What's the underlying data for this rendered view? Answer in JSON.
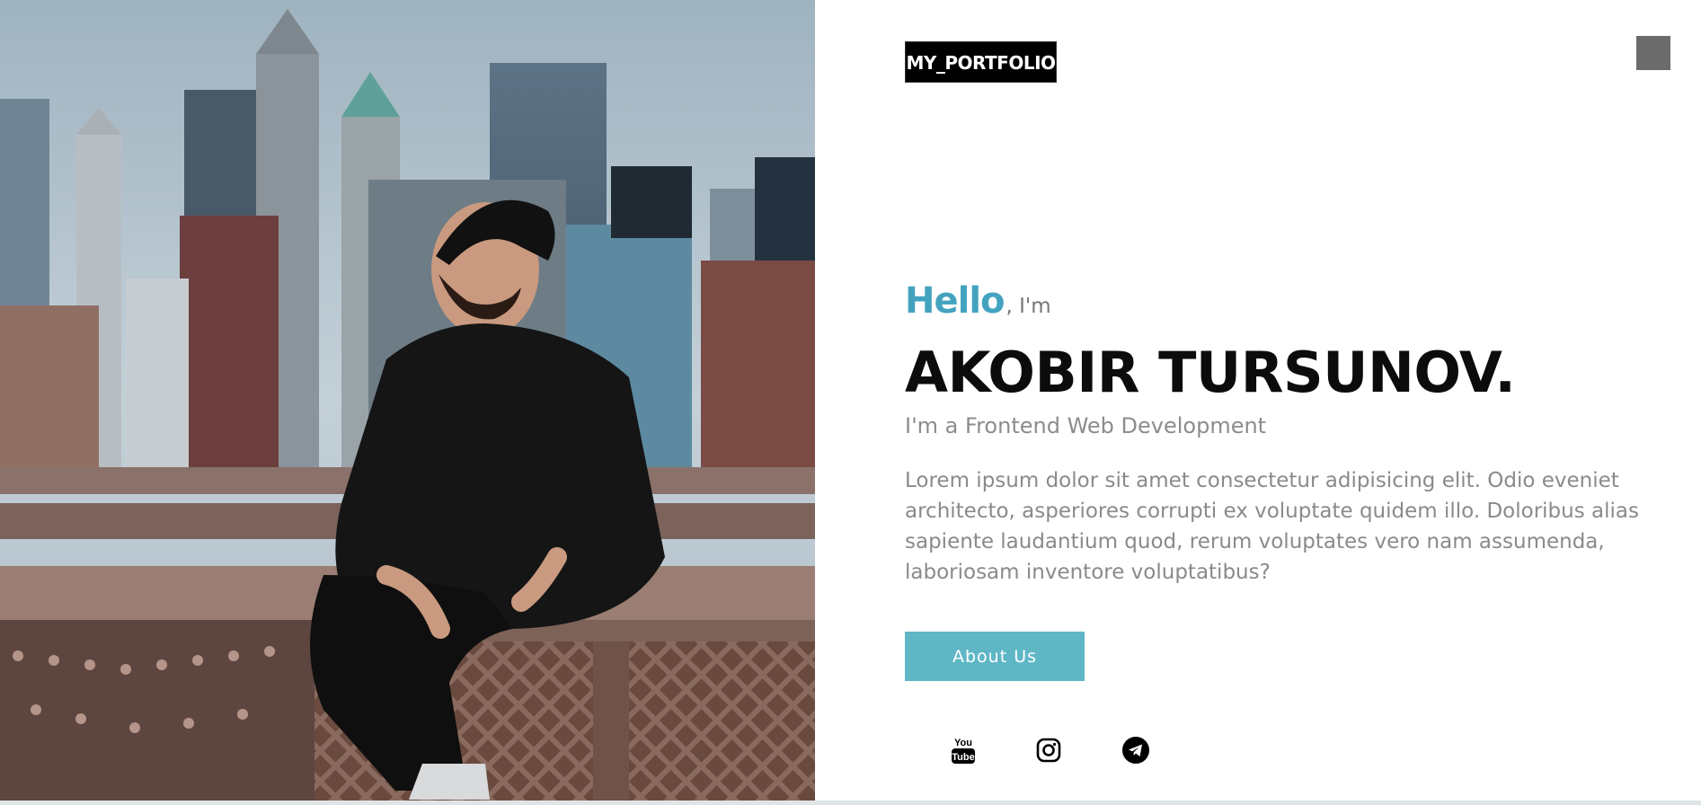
{
  "header": {
    "logo_text": "MY_PORTFOLIO",
    "menu_icon": "menu-toggle-icon"
  },
  "hero": {
    "hello": "Hello",
    "im": ", I'm",
    "name": "AKOBIR TURSUNOV.",
    "role": "I'm a Frontend Web Development",
    "bio": "Lorem ipsum dolor sit amet consectetur adipisicing elit. Odio eveniet architecto, asperiores corrupti ex voluptate quidem illo. Doloribus alias sapiente laudantium quod, rerum voluptates vero nam assumenda, laboriosam inventore voluptatibus?",
    "button_label": "About Us",
    "photo_icon": "portrait-photo"
  },
  "social": [
    {
      "name": "youtube-icon",
      "label": "You Tube"
    },
    {
      "name": "instagram-icon"
    },
    {
      "name": "telegram-icon"
    }
  ],
  "colors": {
    "accent": "#43a3bf",
    "button": "#5fb7c6",
    "heading": "#0c0c0c",
    "body_text": "#8a8a8a",
    "logo_bg": "#000000",
    "menu_toggle": "#6b6b6b"
  }
}
